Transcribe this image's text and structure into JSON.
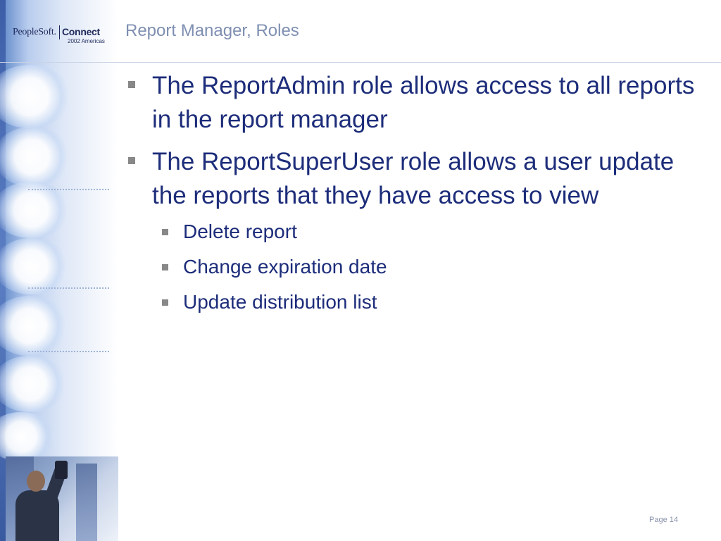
{
  "header": {
    "logo_brand": "PeopleSoft.",
    "logo_connect": "Connect",
    "logo_sub": "2002 Americas",
    "title": "Report Manager, Roles"
  },
  "body": {
    "bullets": [
      "The ReportAdmin role allows access to all reports in the report manager",
      "The ReportSuperUser role allows a user update the reports that they have access to view"
    ],
    "sub_bullets": [
      "Delete report",
      "Change expiration date",
      "Update distribution list"
    ]
  },
  "footer": {
    "page_label": "Page 14"
  },
  "colors": {
    "title": "#7f8fb2",
    "text": "#1d2d7a",
    "bullet": "#888888"
  }
}
